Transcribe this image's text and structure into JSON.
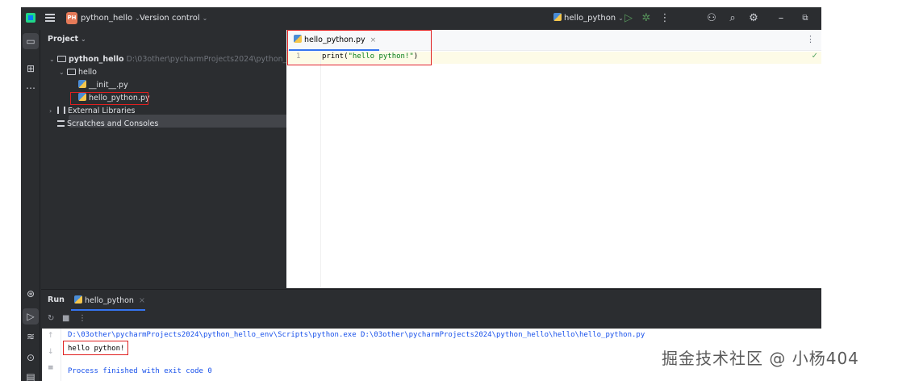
{
  "titlebar": {
    "project_badge": "PH",
    "project_name": "python_hello",
    "version_control": "Version control",
    "run_config": "hello_python"
  },
  "project_panel": {
    "header": "Project",
    "tree": [
      {
        "label": "python_hello",
        "path": "D:\\03other\\pycharmProjects2024\\python_hello"
      },
      {
        "label": "hello"
      },
      {
        "label": "__init__.py"
      },
      {
        "label": "hello_python.py"
      },
      {
        "label": "External Libraries"
      },
      {
        "label": "Scratches and Consoles"
      }
    ]
  },
  "editor": {
    "tab_label": "hello_python.py",
    "line_number": "1",
    "code_prefix": "print(",
    "code_string": "\"hello python!\"",
    "code_suffix": ")"
  },
  "run_panel": {
    "title": "Run",
    "tab_label": "hello_python"
  },
  "console": {
    "command": "D:\\03other\\pycharmProjects2024\\python_hello_env\\Scripts\\python.exe D:\\03other\\pycharmProjects2024\\python_hello\\hello\\hello_python.py",
    "output": "hello python!",
    "exit_message": "Process finished with exit code 0"
  },
  "watermark": "掘金技术社区 @ 小杨404",
  "colors": {
    "accent": "#3574f0",
    "highlight_box": "#e02020",
    "string": "#067d17",
    "console_cmd": "#1750eb"
  },
  "icons": {
    "app": "pycharm-logo-icon",
    "menu": "hamburger-icon",
    "run": "play-icon",
    "debug": "bug-icon",
    "search": "search-icon",
    "settings": "gear-icon",
    "account": "user-icon"
  }
}
